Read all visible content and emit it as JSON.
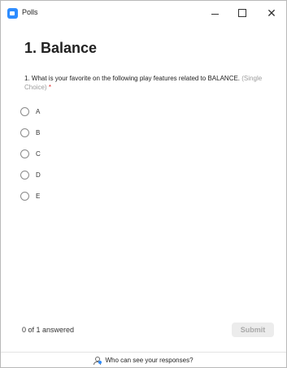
{
  "window": {
    "title": "Polls",
    "accent_color": "#2d8cff"
  },
  "poll": {
    "heading": "1. Balance",
    "question": {
      "text": "1. What is your favorite on the following play features related to BALANCE.",
      "hint": "(Single Choice)",
      "required_marker": "*"
    },
    "options": [
      {
        "label": "A"
      },
      {
        "label": "B"
      },
      {
        "label": "C"
      },
      {
        "label": "D"
      },
      {
        "label": "E"
      }
    ]
  },
  "footer": {
    "answered_status": "0 of 1 answered",
    "submit_label": "Submit",
    "responses_link": "Who can see your responses?"
  }
}
